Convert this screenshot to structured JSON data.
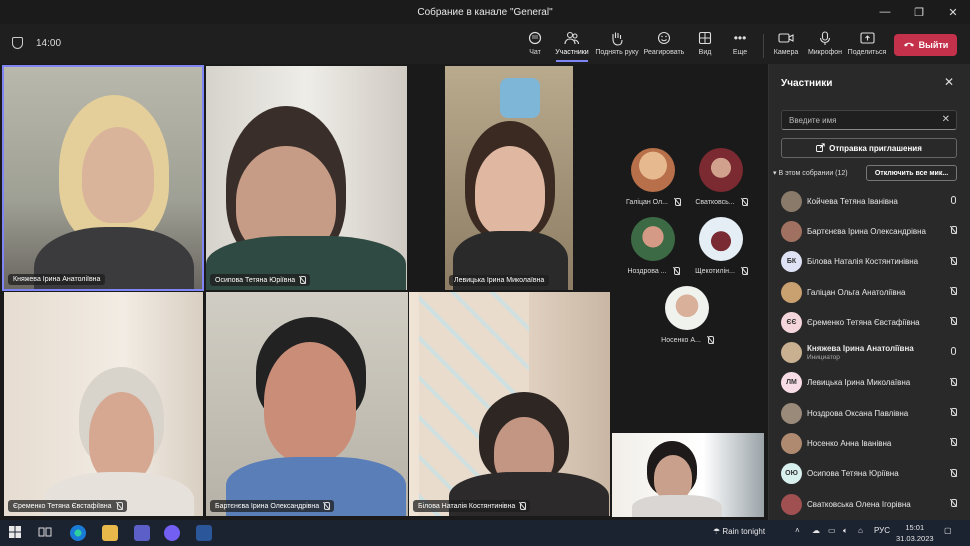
{
  "window": {
    "title": "Собрание в канале \"General\""
  },
  "toolbar": {
    "time": "14:00",
    "chat": "Чат",
    "participants": "Участники",
    "raise_hand": "Поднять руку",
    "react": "Реагировать",
    "view": "Вид",
    "more": "Еще",
    "camera": "Камера",
    "mic": "Микрофон",
    "share": "Поделиться",
    "leave": "Выйти"
  },
  "tiles": [
    {
      "name": "Княжева Ірина Анатоліївна"
    },
    {
      "name": "Осипова Тетяна Юріївна"
    },
    {
      "name": "Левицька Ірина Миколаївна"
    },
    {
      "name": "Єременко Тетяна Євстафіївна"
    },
    {
      "name": "Бартєнєва Ірина Олександрівна"
    },
    {
      "name": "Білова Наталія Костянтинівна"
    }
  ],
  "small_tiles": [
    {
      "name": "Галіцан Ол..."
    },
    {
      "name": "Сватковсь..."
    },
    {
      "name": "Ноздрова ..."
    },
    {
      "name": "Щекотилін..."
    },
    {
      "name": "Носенко А..."
    }
  ],
  "panel": {
    "title": "Участники",
    "search_placeholder": "Введите имя",
    "invite": "Отправка приглашения",
    "in_meeting": "В этом собрании (12)",
    "mute_all": "Отключить все мик...",
    "people": [
      {
        "name": "Койчева Тетяна Іванівна",
        "initials": "",
        "color": "#8a7a6a",
        "mic": "on"
      },
      {
        "name": "Бартєнєва Ірина Олександрівна",
        "initials": "",
        "color": "#a07060",
        "mic": "off"
      },
      {
        "name": "Білова Наталія Костянтинівна",
        "initials": "БК",
        "color": "#dfe3f5",
        "mic": "off"
      },
      {
        "name": "Галіцан Ольга Анатоліївна",
        "initials": "",
        "color": "#c9a070",
        "mic": "off"
      },
      {
        "name": "Єременко Тетяна Євстафіївна",
        "initials": "ЄЄ",
        "color": "#f6d6dd",
        "mic": "off"
      },
      {
        "name": "Княжева Ірина Анатоліївна",
        "initials": "",
        "color": "#c8b090",
        "mic": "on",
        "role": "Инициатор",
        "bold": true
      },
      {
        "name": "Левицька Ірина Миколаївна",
        "initials": "ЛМ",
        "color": "#f8dde6",
        "mic": "off"
      },
      {
        "name": "Ноздрова Оксана Павлівна",
        "initials": "",
        "color": "#9a8a7a",
        "mic": "off"
      },
      {
        "name": "Носенко Анна Іванівна",
        "initials": "",
        "color": "#b08a70",
        "mic": "off"
      },
      {
        "name": "Осипова Тетяна Юріївна",
        "initials": "ОЮ",
        "color": "#d8f0ee",
        "mic": "off"
      },
      {
        "name": "Сватковська Олена Ігорівна",
        "initials": "",
        "color": "#a05050",
        "mic": "off"
      }
    ]
  },
  "taskbar": {
    "weather": "Rain tonight",
    "lang": "РУС",
    "time": "15:01",
    "date": "31.03.2023"
  }
}
